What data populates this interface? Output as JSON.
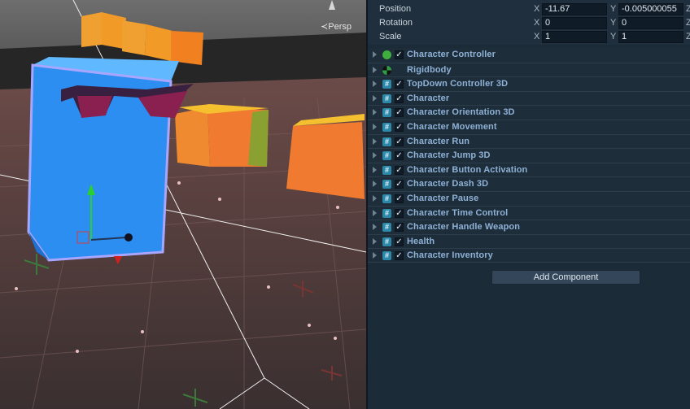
{
  "scene": {
    "camera_label": "≺Persp"
  },
  "transform": {
    "position": {
      "label": "Position",
      "x_axis": "X",
      "x": "-11.67",
      "y_axis": "Y",
      "y": "-0.005000055",
      "z_axis": "Z"
    },
    "rotation": {
      "label": "Rotation",
      "x_axis": "X",
      "x": "0",
      "y_axis": "Y",
      "y": "0",
      "z_axis": "Z"
    },
    "scale": {
      "label": "Scale",
      "x_axis": "X",
      "x": "1",
      "y_axis": "Y",
      "y": "1",
      "z_axis": "Z"
    }
  },
  "components": [
    {
      "name": "Character Controller",
      "icon": "character-controller-icon"
    },
    {
      "name": "Rigidbody",
      "icon": "rigidbody-icon"
    },
    {
      "name": "TopDown Controller 3D",
      "icon": "script-icon"
    },
    {
      "name": "Character",
      "icon": "script-icon"
    },
    {
      "name": "Character Orientation 3D",
      "icon": "script-icon"
    },
    {
      "name": "Character Movement",
      "icon": "script-icon"
    },
    {
      "name": "Character Run",
      "icon": "script-icon"
    },
    {
      "name": "Character Jump 3D",
      "icon": "script-icon"
    },
    {
      "name": "Character Button Activation",
      "icon": "script-icon"
    },
    {
      "name": "Character Dash 3D",
      "icon": "script-icon"
    },
    {
      "name": "Character Pause",
      "icon": "script-icon"
    },
    {
      "name": "Character Time Control",
      "icon": "script-icon"
    },
    {
      "name": "Character Handle Weapon",
      "icon": "script-icon"
    },
    {
      "name": "Health",
      "icon": "script-icon"
    },
    {
      "name": "Character Inventory",
      "icon": "script-icon"
    }
  ],
  "add_component_label": "Add Component",
  "check_glyph": "✓",
  "script_glyph": "#"
}
